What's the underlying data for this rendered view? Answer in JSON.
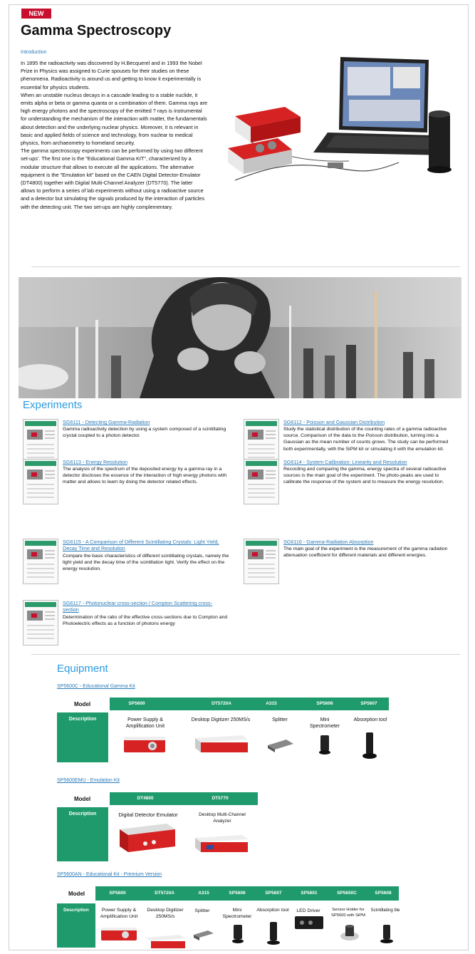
{
  "badge": "NEW",
  "title": "Gamma Spectroscopy",
  "intro": {
    "label": "Introduction",
    "paragraphs": [
      "In 1895 the radioactivity was discovered by H.Becquerel and in 1993 the Nobel Prize in Physics was assigned to Curie spouses for their studies on these phenomena. Radioactivity is around us and getting to know it experimentally is essential for physics students.",
      "When an unstable nucleus decays in a cascade leading to a stable nuclide, it emits alpha or beta or gamma quanta or a combination of them. Gamma rays are high energy photons and the spectroscopy of the emitted ? rays is instrumental for understanding the mechanism of the interaction with matter, the fundamentals about detection and the underlying nuclear physics. Moreover, it is relevant in basic and applied fields of science and technology, from nuclear to medical physics, from archaeometry to homeland security.",
      "The gamma spectroscopy experiments can be performed by using two different set-ups'. The first one is the \"Educational Gamma KIT\", characterized by a modular structure that allows to execute all the applications. The alternative equipment is the \"Emulation kit\" based on the CAEN Digital Detector-Emulator (DT4800) together with Digital Multi-Channel Analyzer (DT5770). The latter allows to perform a series of lab experiments without using a radioactive source and a detector but simulating the signals produced by the interaction of particles with the detecting unit. The two set-ups are highly complementary."
    ]
  },
  "experiments": {
    "title": "Experiments",
    "items": [
      {
        "link": "SG6111 - Detecting Gamma-Radiation",
        "desc": "Gamma radioactivity detection by using a system composed of a scintillating crystal coupled to a photon detector."
      },
      {
        "link": "SG6112 - Poisson and Gaussian Distribution",
        "desc": "Study the statistical distribution of the counting rates of a gamma radioactive source. Comparison of the data to the Poisson distribution, turning into a Gaussian as the mean number of counts grows. The study can be performed both experimentally, with the SiPM kit or simulating it with the emulation kit."
      },
      {
        "link": "SG6113 - Energy Resolution",
        "desc": "The analysis of the spectrum of the deposited energy by a gamma ray in a detector discloses the essence of the interaction of high energy photons with matter and allows to learn by doing the detector related effects."
      },
      {
        "link": "SG6114 - System Calibration: Linearity and Resolution",
        "desc": "Recording and comparing the gamma, energy spectra of several radioactive sources is the main goal of the experiment. The photo-peaks are used to calibrate the response of the system and to measure the energy resolution."
      },
      {
        "link": "SG6115 - A Comparison of Different Scintillating Crystals: Light Yield, Decay Time and Resolution",
        "desc": "Compare the basic characteristics of different scintillating crystals, namely the light yield and the decay time of the scintillation light. Verify the effect on the energy resolution."
      },
      {
        "link": "SG6116 - Gamma-Radiation Absorption",
        "desc": "The main goal of the experiment is the measurement of the gamma radiation attenuation coefficient for different materials and different energies."
      },
      {
        "link": "SG6117 - Photonuclear cross-section / Compton Scattering cross-section",
        "desc": "Determination of the ratio of the effective cross-sections due to Compton and Photoelectric effects as a function of photons energy"
      }
    ]
  },
  "equipment": {
    "title": "Equipment",
    "model_label": "Model",
    "desc_label": "Description",
    "kits": [
      {
        "link": "SP5600C - Educational Gamma Kit",
        "models": [
          "SP5600",
          "DT5720A",
          "A315",
          "SP5606",
          "SP5607"
        ],
        "descs": [
          "Power Supply & Amplification Unit",
          "Desktop Digitizer 250MS/s",
          "Splitter",
          "Mini Spectrometer",
          "Absorption tool"
        ]
      },
      {
        "link": "SP5600EMU - Emulation Kit",
        "models": [
          "DT4800",
          "DT5770"
        ],
        "descs": [
          "Digital Detector Emulator",
          "Desktop Multi-Channel Analyzer"
        ]
      },
      {
        "link": "SP5600AN - Educational Kit - Premium Version",
        "models": [
          "SP5600",
          "DT5720A",
          "A315",
          "SP5606",
          "SP5607",
          "SP5601",
          "SP5650C",
          "SP5608"
        ],
        "descs": [
          "Power Supply & Amplification Unit",
          "Desktop Digitizer 250MS/s",
          "Splitter",
          "Mini Spectrometer",
          "Absorption tool",
          "LED Driver",
          "Sensor Holder for SP5600 with SiPM",
          "Scintillating tile"
        ]
      }
    ]
  },
  "colors": {
    "accent": "#1f9a6d",
    "link": "#2a7ab8",
    "badge": "#c8102e",
    "heading": "#2a9be0"
  }
}
